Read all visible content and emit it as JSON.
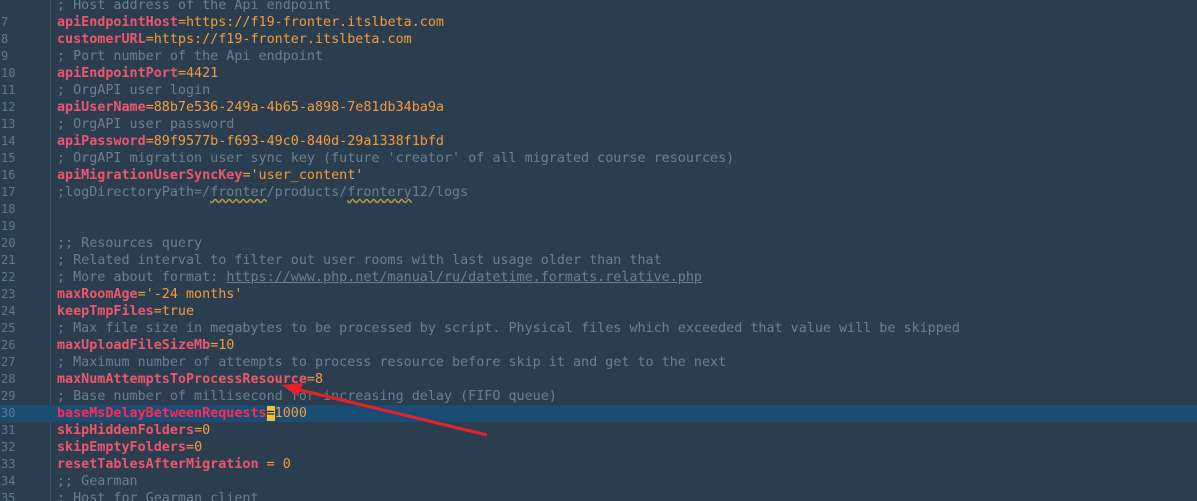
{
  "lines": [
    {
      "n": "",
      "type": "comment",
      "text": "; Host address of the Api endpoint"
    },
    {
      "n": "7",
      "type": "kv",
      "key": "apiEndpointHost",
      "op": "=",
      "value": "https://f19-fronter.itslbeta.com"
    },
    {
      "n": "8",
      "type": "kv",
      "key": "customerURL",
      "op": "=",
      "value": "https://f19-fronter.itslbeta.com"
    },
    {
      "n": "9",
      "type": "comment",
      "text": "; Port number of the Api endpoint"
    },
    {
      "n": "10",
      "type": "kv",
      "key": "apiEndpointPort",
      "op": "=",
      "value": "4421"
    },
    {
      "n": "11",
      "type": "comment",
      "text": "; OrgAPI user login"
    },
    {
      "n": "12",
      "type": "kv",
      "key": "apiUserName",
      "op": "=",
      "value": "88b7e536-249a-4b65-a898-7e81db34ba9a"
    },
    {
      "n": "13",
      "type": "comment",
      "text": "; OrgAPI user password"
    },
    {
      "n": "14",
      "type": "kv",
      "key": "apiPassword",
      "op": "=",
      "value": "89f9577b-f693-49c0-840d-29a1338f1bfd"
    },
    {
      "n": "15",
      "type": "comment",
      "text": "; OrgAPI migration user sync key (future 'creator' of all migrated course resources)"
    },
    {
      "n": "16",
      "type": "kv",
      "key": "apiMigrationUserSyncKey",
      "op": "=",
      "value": "'user_content'"
    },
    {
      "n": "17",
      "type": "logpath",
      "parts": [
        ";logDirectoryPath=/",
        "fronter",
        "/products/",
        "frontery",
        "12/logs"
      ]
    },
    {
      "n": "18",
      "type": "empty"
    },
    {
      "n": "19",
      "type": "empty"
    },
    {
      "n": "20",
      "type": "comment",
      "text": ";; Resources query"
    },
    {
      "n": "21",
      "type": "comment",
      "text": "; Related interval to filter out user rooms with last usage older than that"
    },
    {
      "n": "22",
      "type": "commentlink",
      "text": "; More about format: ",
      "link": "https://www.php.net/manual/ru/datetime.formats.relative.php"
    },
    {
      "n": "23",
      "type": "kv",
      "key": "maxRoomAge",
      "op": "=",
      "value": "'-24 months'"
    },
    {
      "n": "24",
      "type": "kv",
      "key": "keepTmpFiles",
      "op": "=",
      "value": "true"
    },
    {
      "n": "25",
      "type": "comment",
      "text": "; Max file size in megabytes to be processed by script. Physical files which exceeded that value will be skipped"
    },
    {
      "n": "26",
      "type": "kv",
      "key": "maxUploadFileSizeMb",
      "op": "=",
      "value": "10"
    },
    {
      "n": "27",
      "type": "comment",
      "text": "; Maximum number of attempts to process resource before skip it and get to the next"
    },
    {
      "n": "28",
      "type": "kv",
      "key": "maxNumAttemptsToProcessResource",
      "op": "=",
      "value": "8"
    },
    {
      "n": "29",
      "type": "comment",
      "text": "; Base number of millisecond for increasing delay (FIFO queue)"
    },
    {
      "n": "30",
      "type": "kv",
      "key": "baseMsDelayBetweenRequests",
      "op": "=",
      "value": "1000",
      "current": true
    },
    {
      "n": "31",
      "type": "kv",
      "key": "skipHiddenFolders",
      "op": "=",
      "value": "0"
    },
    {
      "n": "32",
      "type": "kv",
      "key": "skipEmptyFolders",
      "op": "=",
      "value": "0"
    },
    {
      "n": "33",
      "type": "kv",
      "key": "resetTablesAfterMigration",
      "op": " = ",
      "value": "0"
    },
    {
      "n": "34",
      "type": "comment",
      "text": ";; Gearman"
    },
    {
      "n": "35",
      "type": "comment",
      "text": "; Host for Gearman client"
    }
  ],
  "colors": {
    "background": "#2b3e50",
    "current_line": "#1a4d73",
    "key": "#f0566a",
    "value": "#f79b3a",
    "comment": "#6b7f91",
    "arrow": "#e8202a",
    "cursor": "#f2c230"
  }
}
